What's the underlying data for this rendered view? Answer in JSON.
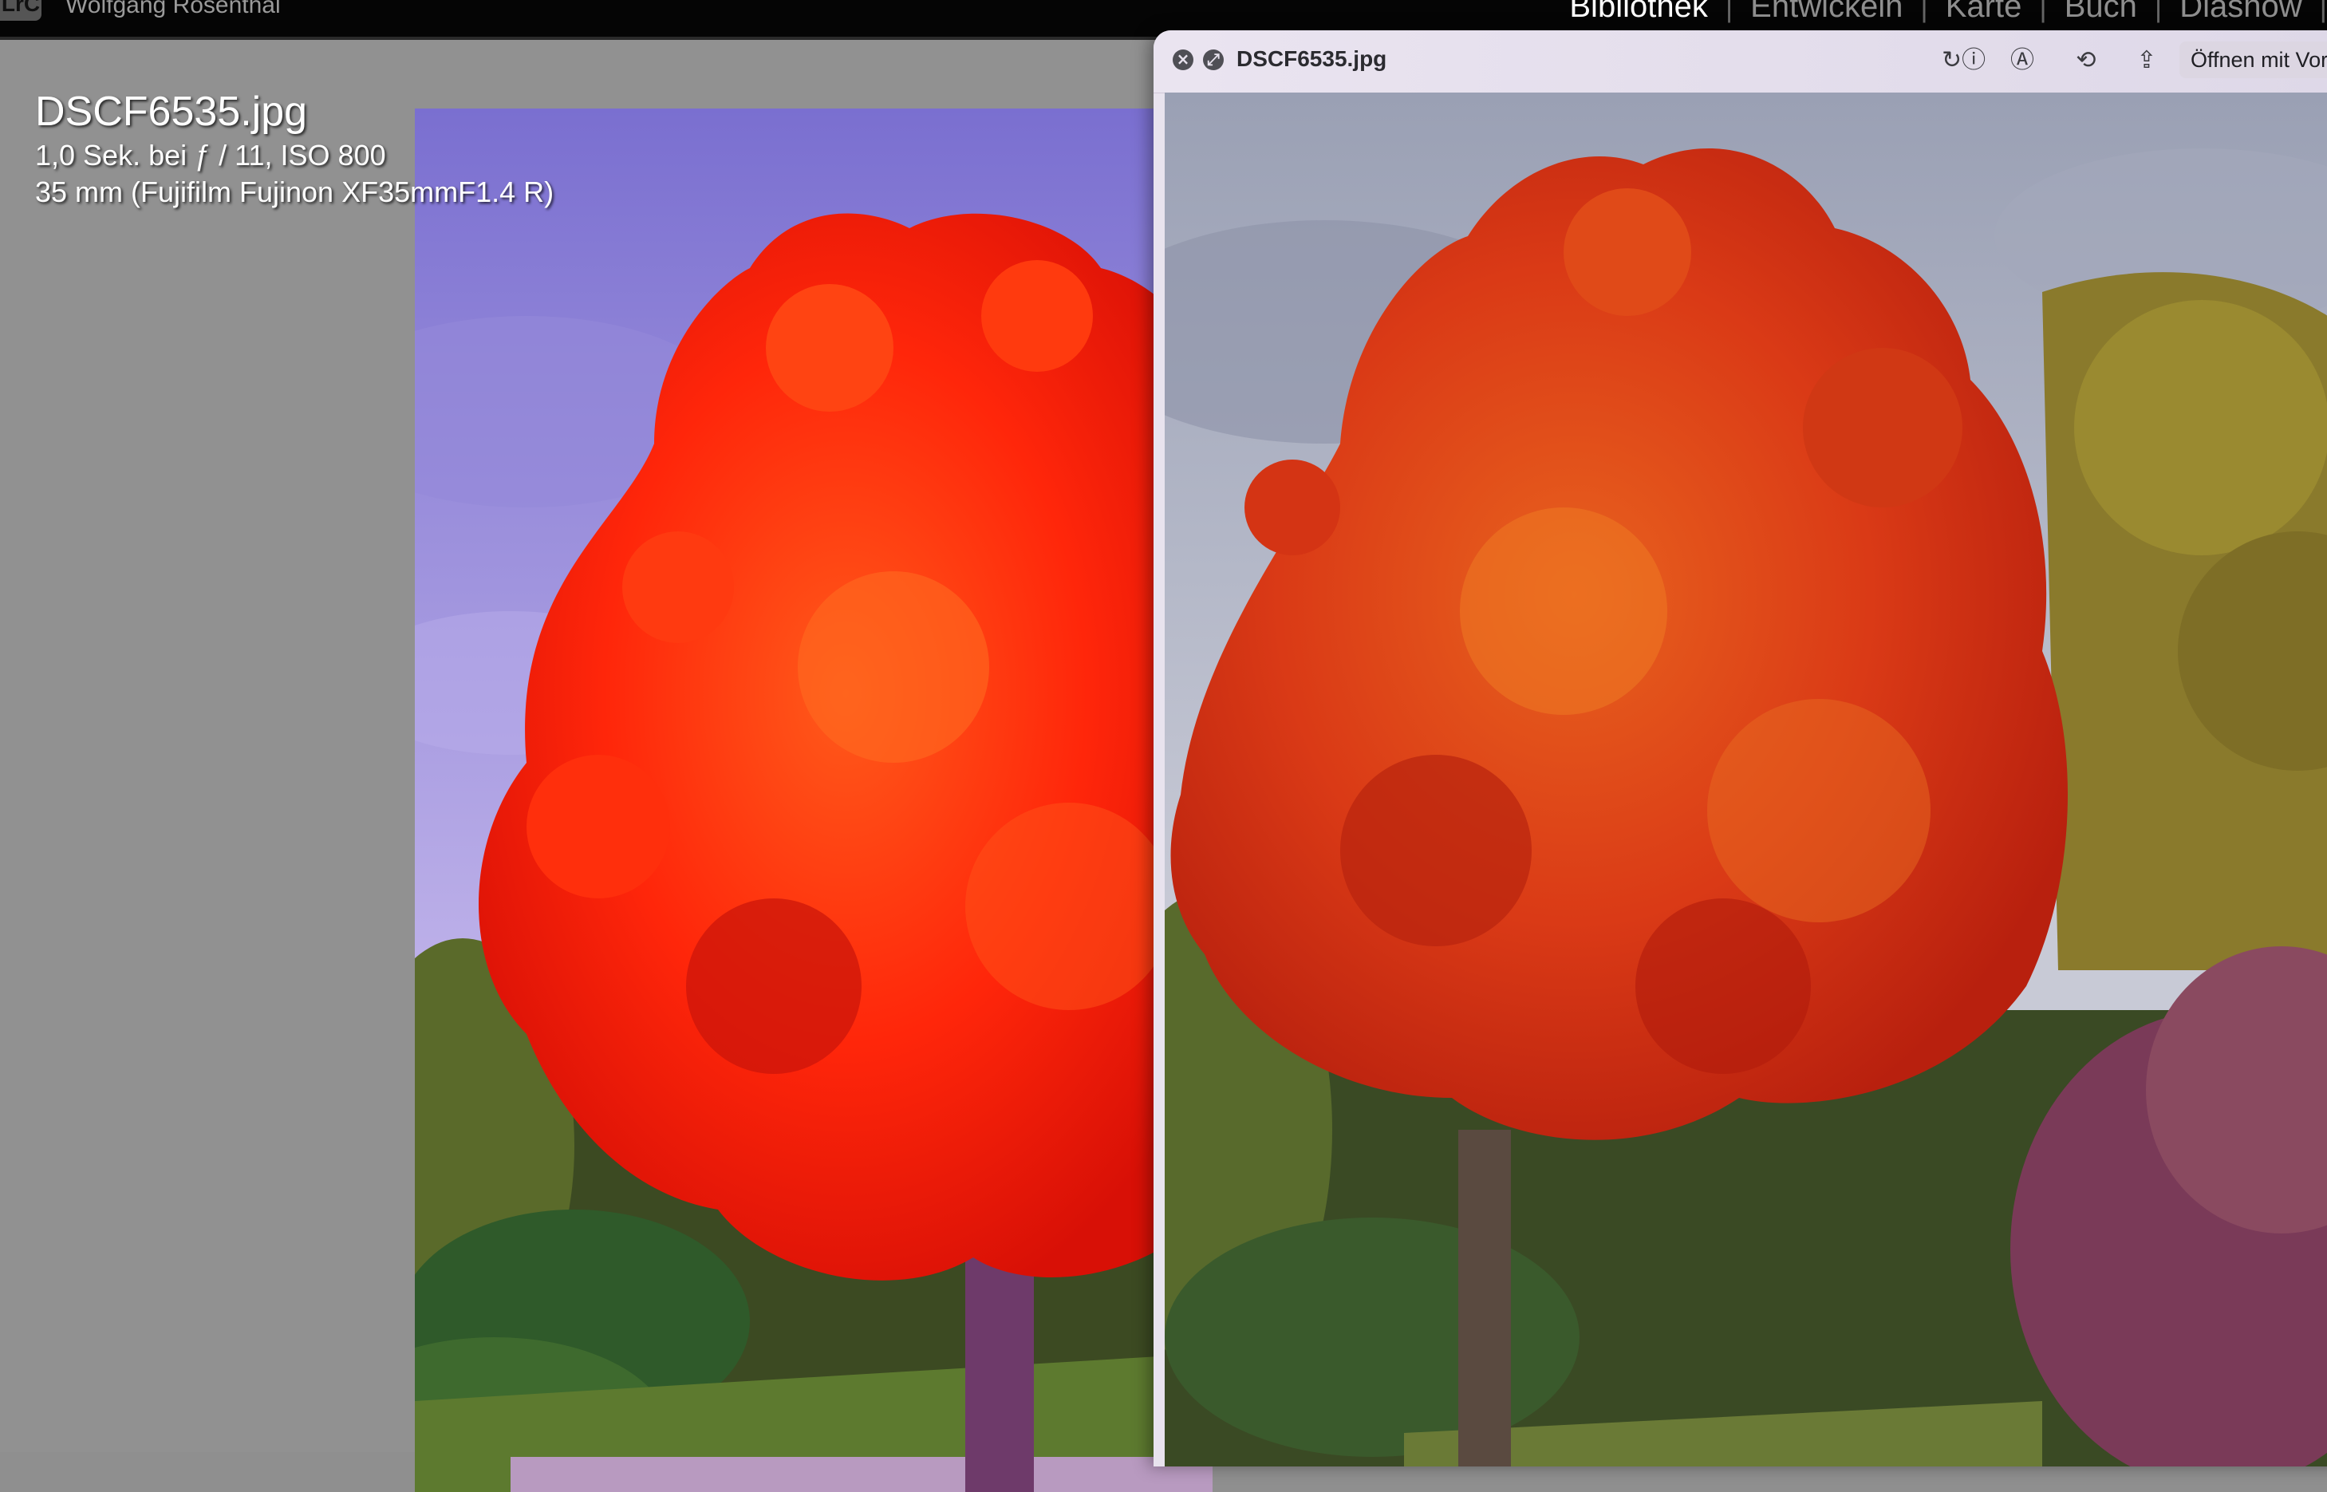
{
  "lightroom": {
    "logo_text": "LrC",
    "user_name": "Wolfgang Rosenthal",
    "modules": [
      {
        "label": "Bibliothek",
        "active": true
      },
      {
        "label": "Entwickeln",
        "active": false
      },
      {
        "label": "Karte",
        "active": false
      },
      {
        "label": "Buch",
        "active": false
      },
      {
        "label": "Diashow",
        "active": false
      }
    ],
    "separator": "|",
    "info_overlay": {
      "filename": "DSCF6535.jpg",
      "exposure": "1,0 Sek. bei ƒ / 11, ISO 800",
      "lens": "35 mm (Fujifilm Fujinon XF35mmF1.4 R)"
    }
  },
  "quicklook": {
    "title": "DSCF6535.jpg",
    "close_icon": "×",
    "fullscreen_icon": "⤢",
    "tools": {
      "rotate_info_icon": "↻ⓘ",
      "markup_icon": "Ⓐ",
      "rotate_icon": "⟲",
      "share_icon": "⇪"
    },
    "open_with_label": "Öffnen mit Vorschau"
  },
  "colors": {
    "lr_background": "#919191",
    "topbar": "#050505",
    "ql_titlebar": "#e6e0ec",
    "tree_lr": "#ff2a0a",
    "tree_ql": "#e0401a"
  }
}
